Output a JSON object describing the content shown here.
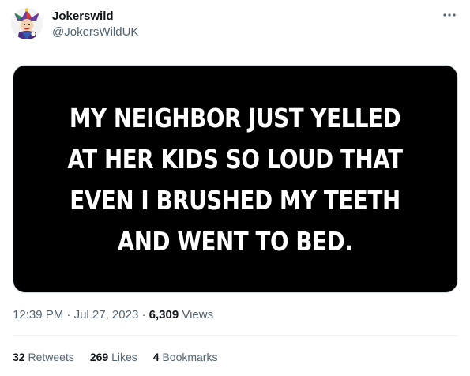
{
  "tweet": {
    "author": {
      "display_name": "Jokerswild",
      "handle": "@JokersWildUK"
    },
    "more_icon": "ellipsis-horizontal-icon",
    "media": {
      "lines": [
        "MY NEIGHBOR JUST YELLED",
        "AT HER KIDS SO LOUD THAT",
        "EVEN I BRUSHED MY TEETH",
        "AND WENT TO BED."
      ],
      "background": "#000000",
      "text_color": "#ffffff"
    },
    "meta": {
      "time": "12:39 PM",
      "separator": "·",
      "date": "Jul 27, 2023",
      "views_count": "6,309",
      "views_label": "Views"
    },
    "stats": {
      "retweets_count": "32",
      "retweets_label": "Retweets",
      "likes_count": "269",
      "likes_label": "Likes",
      "bookmarks_count": "4",
      "bookmarks_label": "Bookmarks"
    }
  },
  "colors": {
    "primary_text": "#0f1419",
    "secondary_text": "#536471",
    "divider": "#eff3f4"
  }
}
